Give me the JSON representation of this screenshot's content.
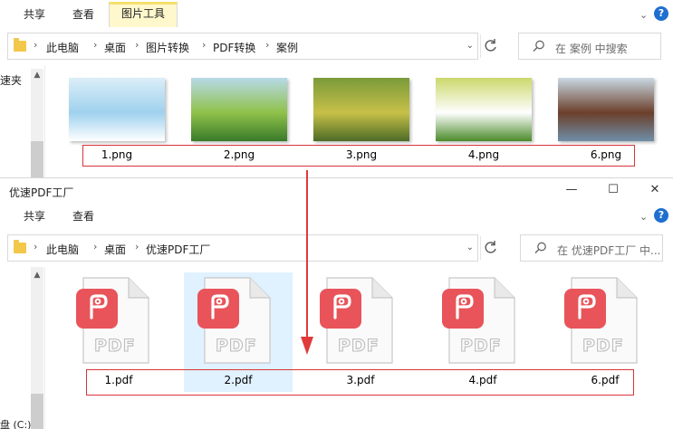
{
  "top_window": {
    "ribbon": {
      "tabs": [
        "共享",
        "查看",
        "图片工具"
      ],
      "active_tab": "图片工具"
    },
    "breadcrumb": [
      "此电脑",
      "桌面",
      "图片转换",
      "PDF转换",
      "案例"
    ],
    "search_placeholder": "在 案例 中搜索",
    "nav_text": [
      "速夹"
    ],
    "files": [
      {
        "label": "1.png",
        "colors": [
          "#dbeef8",
          "#9fd1ee",
          "#ffffff"
        ]
      },
      {
        "label": "2.png",
        "colors": [
          "#b7d9e8",
          "#8fc24a",
          "#3a7a2a"
        ]
      },
      {
        "label": "3.png",
        "colors": [
          "#7a9a3a",
          "#c7c048",
          "#4d6b26"
        ]
      },
      {
        "label": "4.png",
        "colors": [
          "#cbd86c",
          "#ffffff",
          "#4a8a2a"
        ]
      },
      {
        "label": "6.png",
        "colors": [
          "#c9d9e4",
          "#6b3f2a",
          "#6f8ea8"
        ]
      }
    ]
  },
  "bottom_window": {
    "title": "优速PDF工厂",
    "window_controls": {
      "minimize": "—",
      "maximize": "☐",
      "close": "✕"
    },
    "ribbon": {
      "tabs": [
        "共享",
        "查看"
      ]
    },
    "breadcrumb": [
      "此电脑",
      "桌面",
      "优速PDF工厂"
    ],
    "search_placeholder": "在 优速PDF工厂 中...",
    "nav_text": [
      "盘 (C:)"
    ],
    "files": [
      {
        "label": "1.pdf",
        "selected": false
      },
      {
        "label": "2.pdf",
        "selected": true
      },
      {
        "label": "3.pdf",
        "selected": false
      },
      {
        "label": "4.pdf",
        "selected": false
      },
      {
        "label": "6.pdf",
        "selected": false
      }
    ],
    "pdf_badge_text": "PDF"
  },
  "colors": {
    "accent": "#1e6fd0",
    "annotation_red": "#d9343b",
    "pdf_red": "#e8545a",
    "selection": "#cce8ff"
  }
}
